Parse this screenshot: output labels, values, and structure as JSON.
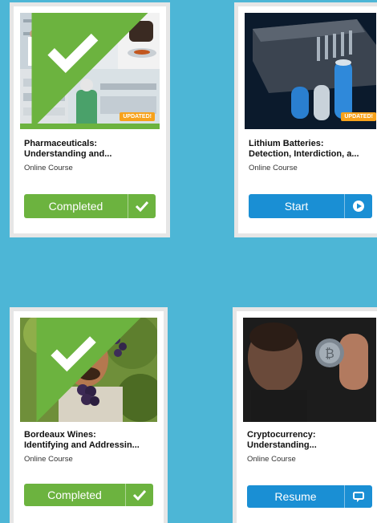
{
  "cards": [
    {
      "title": "Pharmaceuticals:\nUnderstanding and...",
      "type": "Online Course",
      "badge": "UPDATED!",
      "button_label": "Completed",
      "button_icon": "check-icon",
      "status": "completed",
      "accent": "#6cb33f"
    },
    {
      "title": "Lithium Batteries:\nDetection, Interdiction, a...",
      "type": "Online Course",
      "badge": "UPDATED!",
      "button_label": "Start",
      "button_icon": "play-circle-icon",
      "status": "not-started",
      "accent": "#1a8fd4"
    },
    {
      "title": "Bordeaux Wines:\nIdentifying and Addressin...",
      "type": "Online Course",
      "button_label": "Completed",
      "button_icon": "check-icon",
      "status": "completed",
      "accent": "#6cb33f"
    },
    {
      "title": "Cryptocurrency:\nUnderstanding...",
      "type": "Online Course",
      "button_label": "Resume",
      "button_icon": "resume-icon",
      "status": "in-progress",
      "accent": "#1a8fd4"
    }
  ]
}
